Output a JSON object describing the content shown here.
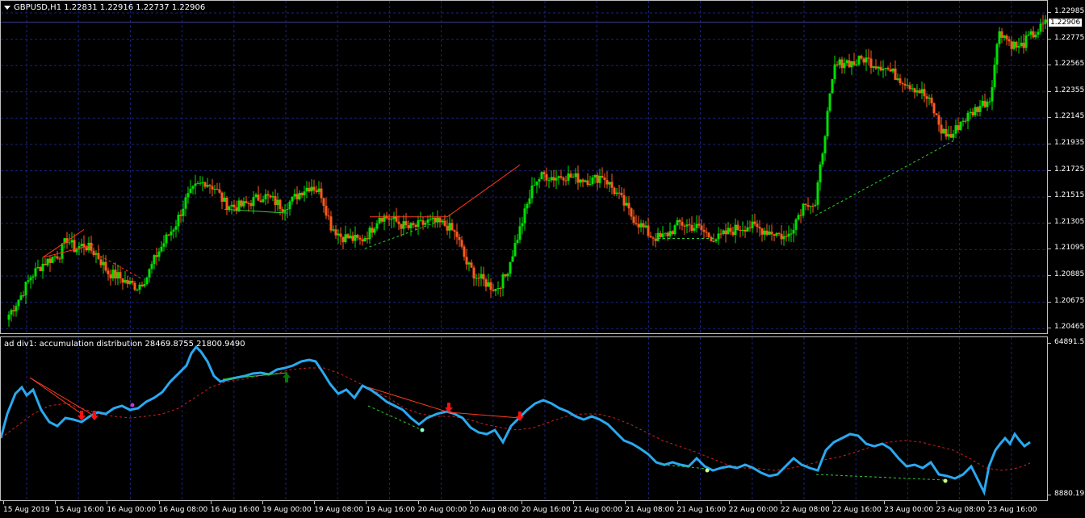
{
  "main": {
    "title": "GBPUSD,H1  1.22831 1.22916 1.22737 1.22906",
    "current_price": "1.22906",
    "price_labels": [
      "1.22985",
      "1.22775",
      "1.22565",
      "1.22355",
      "1.22145",
      "1.21935",
      "1.21725",
      "1.21515",
      "1.21305",
      "1.21095",
      "1.20885",
      "1.20675",
      "1.20465"
    ]
  },
  "indicator": {
    "title": "ad div1:   accumulation distribution 28469.8755 21800.9490",
    "max_label": "64891.5391",
    "min_label": "8880.1953"
  },
  "time_labels": [
    "15 Aug 2019",
    "15 Aug 16:00",
    "16 Aug 00:00",
    "16 Aug 08:00",
    "16 Aug 16:00",
    "19 Aug 00:00",
    "19 Aug 08:00",
    "19 Aug 16:00",
    "20 Aug 00:00",
    "20 Aug 08:00",
    "20 Aug 16:00",
    "21 Aug 00:00",
    "21 Aug 08:00",
    "21 Aug 16:00",
    "22 Aug 00:00",
    "22 Aug 08:00",
    "22 Aug 16:00",
    "23 Aug 00:00",
    "23 Aug 08:00",
    "23 Aug 16:00"
  ],
  "colors": {
    "background": "#000000",
    "bull_candle": "#00e000",
    "bear_candle": "#ff5a1e",
    "grid": "#1a237e",
    "ad_line": "#2aa9f0",
    "ad_signal": "#cc2020",
    "divergence_bear": "#ff3a1a",
    "divergence_bull": "#33cc33",
    "arrow_down": "#ff1010",
    "arrow_up": "#007a00"
  },
  "chart_data": {
    "type": "candlestick",
    "symbol": "GBPUSD",
    "timeframe": "H1",
    "ohlc_last": {
      "open": 1.22831,
      "high": 1.22916,
      "low": 1.22737,
      "close": 1.22906
    },
    "ylim": [
      1.20465,
      1.22985
    ],
    "close_path": [
      [
        0,
        1.206
      ],
      [
        5,
        1.2075
      ],
      [
        9,
        1.209
      ],
      [
        14,
        1.21
      ],
      [
        18,
        1.2105
      ],
      [
        21,
        1.2108
      ],
      [
        24,
        1.212
      ],
      [
        27,
        1.2112
      ],
      [
        31,
        1.2115
      ],
      [
        36,
        1.2108
      ],
      [
        41,
        1.2093
      ],
      [
        45,
        1.209
      ],
      [
        49,
        1.2085
      ],
      [
        53,
        1.2082
      ],
      [
        57,
        1.209
      ],
      [
        61,
        1.2107
      ],
      [
        65,
        1.212
      ],
      [
        69,
        1.2132
      ],
      [
        73,
        1.215
      ],
      [
        77,
        1.216
      ],
      [
        81,
        1.2165
      ],
      [
        85,
        1.216
      ],
      [
        89,
        1.2148
      ],
      [
        93,
        1.2145
      ],
      [
        97,
        1.2146
      ],
      [
        101,
        1.215
      ],
      [
        105,
        1.2154
      ],
      [
        109,
        1.215
      ],
      [
        113,
        1.2145
      ],
      [
        117,
        1.215
      ],
      [
        121,
        1.2158
      ],
      [
        125,
        1.2162
      ],
      [
        129,
        1.2155
      ],
      [
        133,
        1.213
      ],
      [
        137,
        1.2122
      ],
      [
        141,
        1.212
      ],
      [
        145,
        1.2118
      ],
      [
        149,
        1.2125
      ],
      [
        153,
        1.2138
      ],
      [
        157,
        1.2136
      ],
      [
        161,
        1.2132
      ],
      [
        165,
        1.2128
      ],
      [
        169,
        1.213
      ],
      [
        173,
        1.2133
      ],
      [
        177,
        1.2132
      ],
      [
        181,
        1.213
      ],
      [
        185,
        1.2122
      ],
      [
        189,
        1.21
      ],
      [
        193,
        1.209
      ],
      [
        197,
        1.2085
      ],
      [
        201,
        1.208
      ],
      [
        205,
        1.209
      ],
      [
        209,
        1.2115
      ],
      [
        213,
        1.214
      ],
      [
        217,
        1.2165
      ],
      [
        221,
        1.217
      ],
      [
        225,
        1.2168
      ],
      [
        229,
        1.217
      ],
      [
        233,
        1.2168
      ],
      [
        237,
        1.2167
      ],
      [
        241,
        1.2166
      ],
      [
        245,
        1.217
      ],
      [
        249,
        1.216
      ],
      [
        253,
        1.215
      ],
      [
        257,
        1.2138
      ],
      [
        261,
        1.213
      ],
      [
        265,
        1.2122
      ],
      [
        269,
        1.212
      ],
      [
        273,
        1.2125
      ],
      [
        277,
        1.2132
      ],
      [
        281,
        1.213
      ],
      [
        285,
        1.2128
      ],
      [
        289,
        1.2122
      ],
      [
        293,
        1.212
      ],
      [
        297,
        1.2125
      ],
      [
        301,
        1.2128
      ],
      [
        305,
        1.213
      ],
      [
        309,
        1.2128
      ],
      [
        313,
        1.2126
      ],
      [
        317,
        1.2124
      ],
      [
        321,
        1.212
      ],
      [
        325,
        1.2135
      ],
      [
        329,
        1.215
      ],
      [
        333,
        1.2145
      ],
      [
        337,
        1.2205
      ],
      [
        341,
        1.2255
      ],
      [
        345,
        1.226
      ],
      [
        349,
        1.2258
      ],
      [
        353,
        1.2262
      ],
      [
        357,
        1.2258
      ],
      [
        361,
        1.2256
      ],
      [
        365,
        1.225
      ],
      [
        369,
        1.2245
      ],
      [
        373,
        1.224
      ],
      [
        377,
        1.2235
      ],
      [
        381,
        1.2225
      ],
      [
        385,
        1.2205
      ],
      [
        389,
        1.22
      ],
      [
        393,
        1.2212
      ],
      [
        397,
        1.2218
      ],
      [
        401,
        1.2225
      ],
      [
        405,
        1.223
      ],
      [
        409,
        1.2285
      ],
      [
        413,
        1.2275
      ],
      [
        417,
        1.227
      ],
      [
        421,
        1.2278
      ],
      [
        425,
        1.2284
      ],
      [
        429,
        1.2291
      ]
    ],
    "ad_indicator": {
      "ylim": [
        8880.1953,
        64891.5391
      ],
      "values_last": [
        28469.8755,
        21800.949
      ]
    }
  }
}
